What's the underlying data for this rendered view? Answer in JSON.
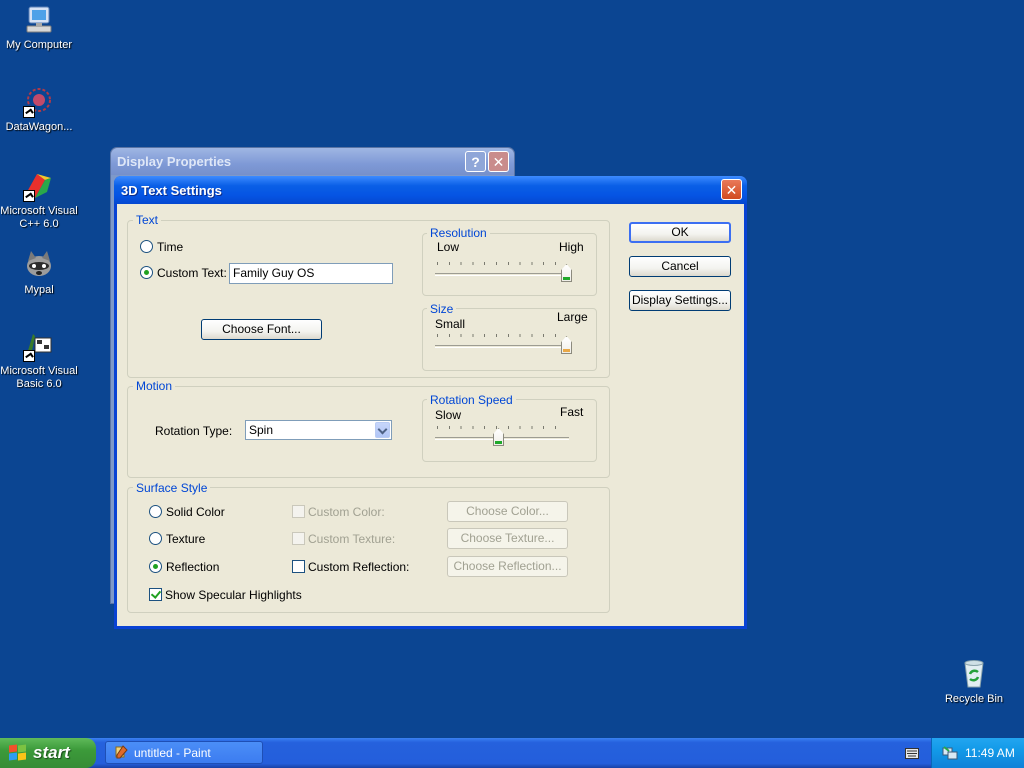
{
  "desktop": {
    "icons": [
      {
        "label": "My Computer",
        "icon": "my-computer-icon"
      },
      {
        "label": "DataWagon...",
        "icon": "datawagon-icon"
      },
      {
        "label": "Microsoft Visual C++ 6.0",
        "icon": "visual-cpp-icon"
      },
      {
        "label": "Mypal",
        "icon": "mypal-raccoon-icon"
      },
      {
        "label": "Microsoft Visual Basic 6.0",
        "icon": "visual-basic-icon"
      },
      {
        "label": "Recycle Bin",
        "icon": "recycle-bin-icon"
      }
    ]
  },
  "back_window": {
    "title": "Display Properties",
    "help_glyph": "?",
    "close_glyph": "✕"
  },
  "dialog": {
    "title": "3D Text Settings",
    "close_glyph": "✕",
    "text_group": {
      "label": "Text",
      "time_label": "Time",
      "custom_text_label": "Custom Text:",
      "custom_text_value": "Family Guy OS",
      "choose_font_label": "Choose Font...",
      "selected": "custom_text"
    },
    "resolution": {
      "label": "Resolution",
      "min_label": "Low",
      "max_label": "High",
      "value_fraction": 1.0
    },
    "size": {
      "label": "Size",
      "min_label": "Small",
      "max_label": "Large",
      "value_fraction": 1.0
    },
    "motion": {
      "label": "Motion",
      "rotation_type_label": "Rotation Type:",
      "rotation_type_value": "Spin"
    },
    "rotation_speed": {
      "label": "Rotation Speed",
      "min_label": "Slow",
      "max_label": "Fast",
      "value_fraction": 0.47
    },
    "surface": {
      "label": "Surface Style",
      "solid_color_label": "Solid Color",
      "texture_label": "Texture",
      "reflection_label": "Reflection",
      "selected": "reflection",
      "custom_color_label": "Custom Color:",
      "custom_texture_label": "Custom Texture:",
      "custom_reflection_label": "Custom Reflection:",
      "choose_color_label": "Choose Color...",
      "choose_texture_label": "Choose Texture...",
      "choose_reflection_label": "Choose Reflection...",
      "specular_label": "Show Specular Highlights",
      "specular_checked": true
    },
    "buttons": {
      "ok_label": "OK",
      "cancel_label": "Cancel",
      "display_settings_label": "Display Settings..."
    }
  },
  "taskbar": {
    "start_label": "start",
    "task_label": "untitled - Paint",
    "clock": "11:49 AM"
  },
  "colors": {
    "desktop_bg": "#0b4592",
    "dialog_title_blue": "#0554e3",
    "group_label_blue": "#0046d5",
    "start_green": "#3c9a3a"
  }
}
